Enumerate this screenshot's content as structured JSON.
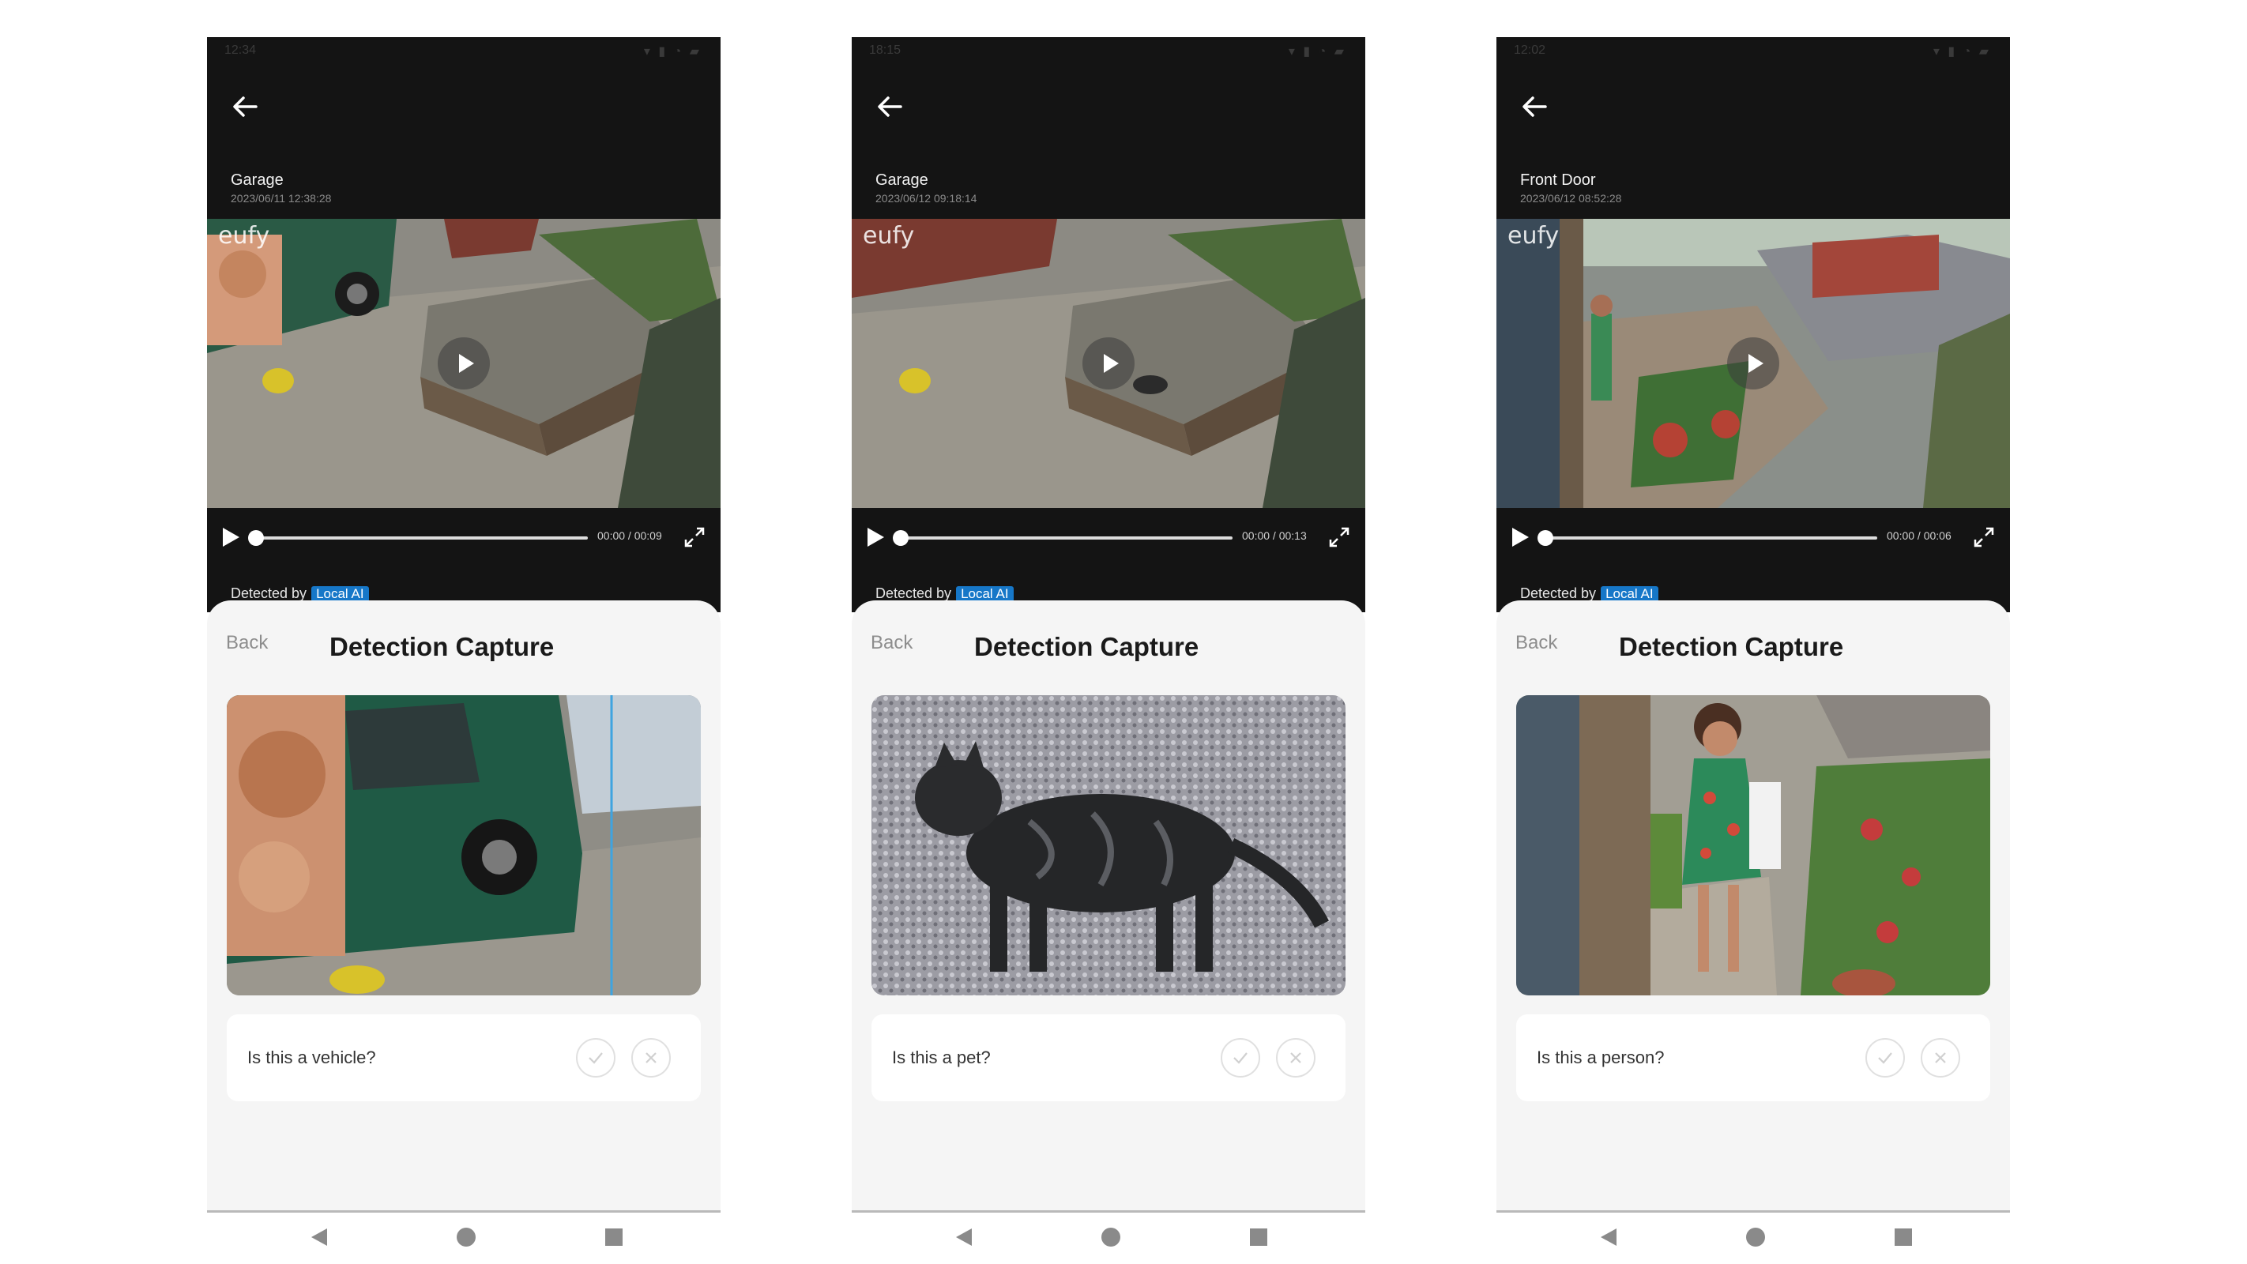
{
  "screens": [
    {
      "status_time": "12:34",
      "camera_name": "Garage",
      "event_time": "2023/06/11 12:38:28",
      "video_watermark": "eufy",
      "timecode": "00:00 / 00:09",
      "detected_label": "Detected by",
      "detected_badge": "Local AI",
      "back_label": "Back",
      "title": "Detection Capture",
      "question": "Is this a vehicle?",
      "capture_icon": "vehicle-capture-image"
    },
    {
      "status_time": "18:15",
      "camera_name": "Garage",
      "event_time": "2023/06/12 09:18:14",
      "video_watermark": "eufy",
      "timecode": "00:00 / 00:13",
      "detected_label": "Detected by",
      "detected_badge": "Local AI",
      "back_label": "Back",
      "title": "Detection Capture",
      "question": "Is this a pet?",
      "capture_icon": "cat-capture-image"
    },
    {
      "status_time": "12:02",
      "camera_name": "Front Door",
      "event_time": "2023/06/12 08:52:28",
      "video_watermark": "eufy",
      "timecode": "00:00 / 00:06",
      "detected_label": "Detected by",
      "detected_badge": "Local AI",
      "back_label": "Back",
      "title": "Detection Capture",
      "question": "Is this a person?",
      "capture_icon": "person-capture-image"
    }
  ],
  "colors": {
    "dark_header": "#141414",
    "sheet_background": "#f5f5f5",
    "badge_blue": "#1677c8",
    "van_green": "#1f5a45"
  }
}
